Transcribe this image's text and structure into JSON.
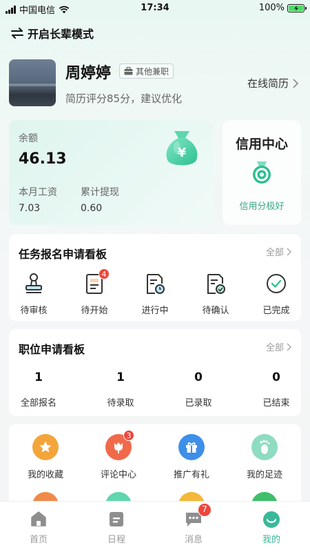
{
  "status_bar": {
    "carrier": "中国电信",
    "time": "17:34",
    "battery": "100%"
  },
  "elder_mode": {
    "label": "开启长辈模式"
  },
  "profile": {
    "name": "周婷婷",
    "job_tag": "其他兼职",
    "score_text": "简历评分85分，建议优化",
    "online_resume": "在线简历"
  },
  "wallet": {
    "balance_label": "余额",
    "balance_value": "46.13",
    "monthly_wage_label": "本月工资",
    "monthly_wage_value": "7.03",
    "total_withdraw_label": "累计提现",
    "total_withdraw_value": "0.60"
  },
  "credit": {
    "title": "信用中心",
    "subtitle": "信用分极好"
  },
  "task_board": {
    "title": "任务报名申请看板",
    "all_label": "全部",
    "items": [
      {
        "label": "待审核",
        "icon": "stamp-icon"
      },
      {
        "label": "待开始",
        "icon": "document-icon",
        "badge": "4"
      },
      {
        "label": "进行中",
        "icon": "document-clock-icon"
      },
      {
        "label": "待确认",
        "icon": "document-check-icon"
      },
      {
        "label": "已完成",
        "icon": "check-circle-icon"
      }
    ]
  },
  "job_board": {
    "title": "职位申请看板",
    "all_label": "全部",
    "items": [
      {
        "value": "1",
        "label": "全部报名"
      },
      {
        "value": "1",
        "label": "待录取"
      },
      {
        "value": "0",
        "label": "已录取"
      },
      {
        "value": "0",
        "label": "已结束"
      }
    ]
  },
  "services": {
    "items": [
      {
        "label": "我的收藏",
        "icon": "star-icon",
        "color": "#f3a53b"
      },
      {
        "label": "评论中心",
        "icon": "tulip-icon",
        "color": "#f06a4a",
        "badge": "3"
      },
      {
        "label": "推广有礼",
        "icon": "gift-icon",
        "color": "#3d8fe8"
      },
      {
        "label": "我的足迹",
        "icon": "footprint-icon",
        "color": "#8edcc2"
      }
    ]
  },
  "tabbar": {
    "items": [
      {
        "label": "首页",
        "icon": "home-icon"
      },
      {
        "label": "日程",
        "icon": "calendar-icon"
      },
      {
        "label": "消息",
        "icon": "message-icon",
        "badge": "7"
      },
      {
        "label": "我的",
        "icon": "profile-face-icon",
        "active": true
      }
    ]
  },
  "colors": {
    "accent": "#3ab89a",
    "badge": "#f0453a"
  }
}
